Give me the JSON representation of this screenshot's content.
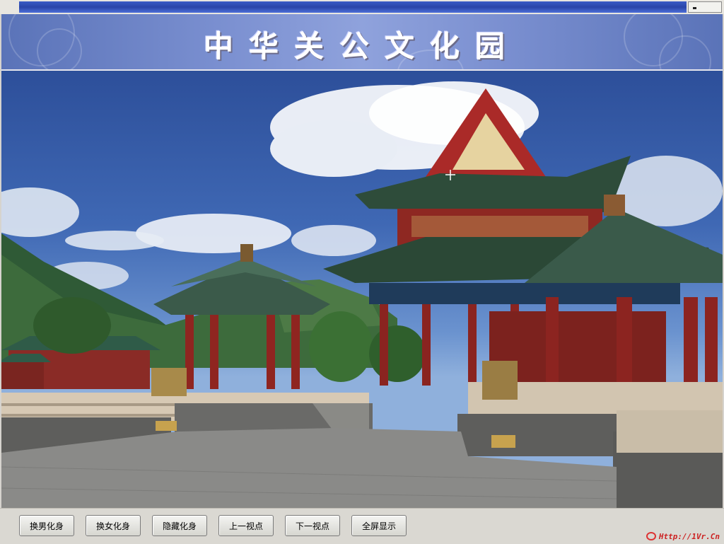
{
  "window": {
    "title": "中华关公文化园"
  },
  "toolbar": {
    "buttons": [
      {
        "label": "换男化身"
      },
      {
        "label": "换女化身"
      },
      {
        "label": "隐藏化身"
      },
      {
        "label": "上一视点"
      },
      {
        "label": "下一视点"
      },
      {
        "label": "全屏显示"
      }
    ]
  },
  "footer": {
    "url": "Http://1Vr.Cn"
  },
  "icons": {
    "logo": "1vr-logo-icon",
    "cursor": "crosshair-cursor-icon"
  },
  "colors": {
    "banner": "#7a8fd0",
    "titlebar": "#2a45a8",
    "logo_red": "#cc2222"
  }
}
